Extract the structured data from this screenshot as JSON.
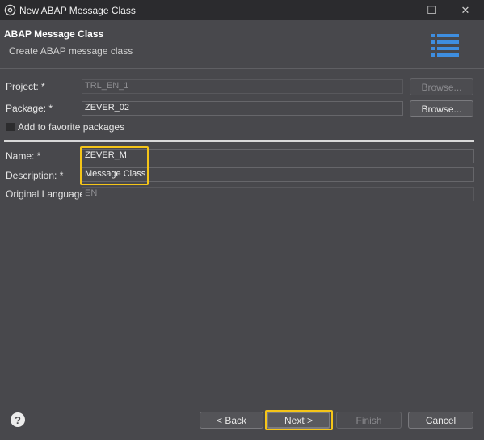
{
  "window": {
    "title": "New ABAP Message Class",
    "minimize_glyph": "—",
    "maximize_glyph": "☐",
    "close_glyph": "✕"
  },
  "header": {
    "title": "ABAP Message Class",
    "subtitle": "Create ABAP message class"
  },
  "project": {
    "label": "Project: *",
    "value": "TRL_EN_1",
    "browse_label": "Browse..."
  },
  "package": {
    "label": "Package: *",
    "value": "ZEVER_02",
    "browse_label": "Browse..."
  },
  "favorite": {
    "label": "Add to favorite packages",
    "checked": false
  },
  "name": {
    "label": "Name: *",
    "value": "ZEVER_M"
  },
  "description": {
    "label": "Description: *",
    "value": "Message Class"
  },
  "language": {
    "label": "Original Language:",
    "value": "EN"
  },
  "footer": {
    "help_glyph": "?",
    "back_label": "< Back",
    "next_label": "Next >",
    "finish_label": "Finish",
    "cancel_label": "Cancel"
  },
  "colors": {
    "highlight": "#f5c518",
    "background": "#48484c"
  }
}
